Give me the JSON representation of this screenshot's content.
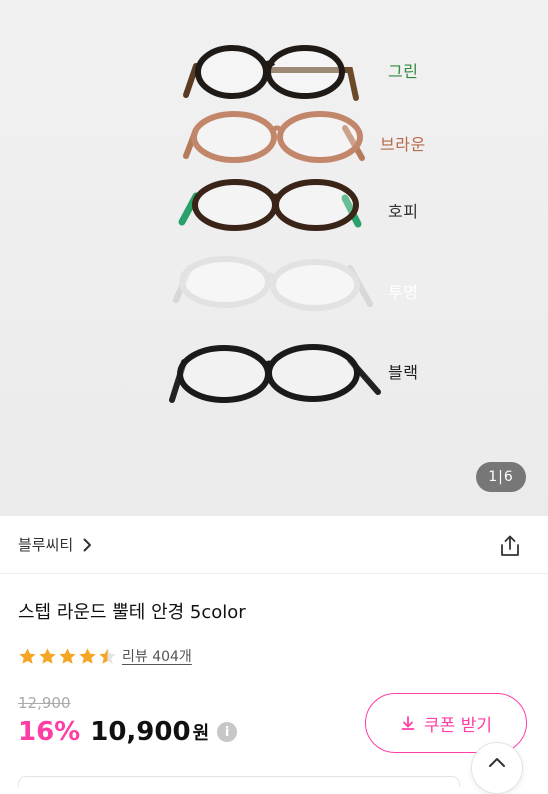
{
  "hero": {
    "labels": [
      {
        "text": "그린",
        "color": "#2f8a3a"
      },
      {
        "text": "브라운",
        "color": "#b56a4a"
      },
      {
        "text": "호피",
        "color": "#333333"
      },
      {
        "text": "투명",
        "color": "#ffffff"
      },
      {
        "text": "블랙",
        "color": "#222222"
      }
    ],
    "page_indicator": "1|6"
  },
  "store": {
    "name": "블루씨티"
  },
  "product": {
    "title": "스텝 라운드 뿔테 안경 5color",
    "rating": 4.5,
    "review_label": "리뷰 404개",
    "original_price": "12,900",
    "discount": "16%",
    "sale_price": "10,900",
    "currency": "원",
    "info_glyph": "i"
  },
  "coupon": {
    "label": "쿠폰 받기"
  },
  "icons": {
    "store_chevron": "chevron-right-icon",
    "share": "share-icon",
    "info": "info-icon",
    "download": "download-icon",
    "scroll_top": "chevron-up-icon"
  },
  "colors": {
    "accent": "#ff3ea5",
    "star": "#f5a524"
  }
}
